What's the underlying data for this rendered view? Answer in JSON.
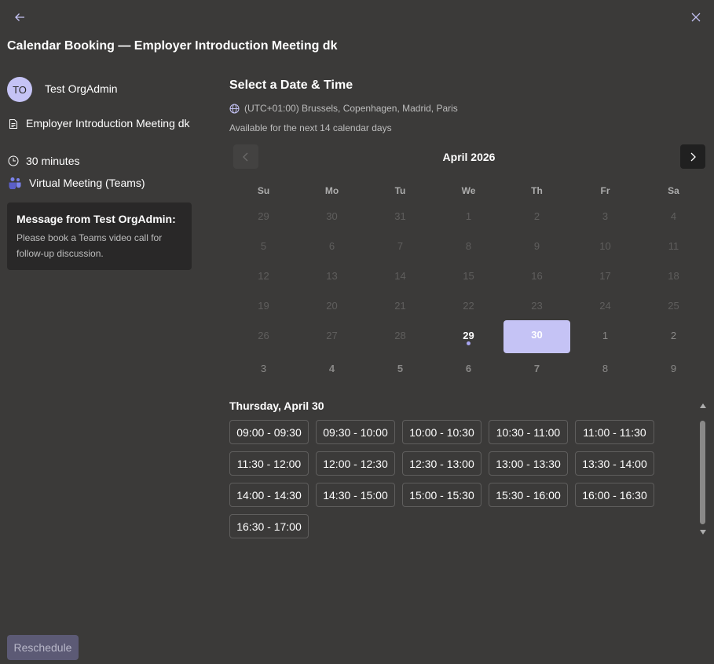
{
  "header": {
    "title": "Calendar Booking — Employer Introduction Meeting dk",
    "back_icon": "arrow-left-icon",
    "close_icon": "close-icon"
  },
  "organizer": {
    "initials": "TO",
    "name": "Test OrgAdmin"
  },
  "meeting": {
    "title": "Employer Introduction Meeting dk",
    "duration": "30 minutes",
    "location": "Virtual Meeting (Teams)"
  },
  "message": {
    "title": "Message from Test OrgAdmin:",
    "text": "Please book a Teams video call for follow-up discussion."
  },
  "scheduler": {
    "title": "Select a Date & Time",
    "timezone": "(UTC+01:00) Brussels, Copenhagen, Madrid, Paris",
    "availability": "Available for the next 14 calendar days",
    "month_label": "April 2026",
    "weekdays": [
      "Su",
      "Mo",
      "Tu",
      "We",
      "Th",
      "Fr",
      "Sa"
    ],
    "weeks": [
      [
        "29",
        "30",
        "31",
        "1",
        "2",
        "3",
        "4"
      ],
      [
        "5",
        "6",
        "7",
        "8",
        "9",
        "10",
        "11"
      ],
      [
        "12",
        "13",
        "14",
        "15",
        "16",
        "17",
        "18"
      ],
      [
        "19",
        "20",
        "21",
        "22",
        "23",
        "24",
        "25"
      ],
      [
        "26",
        "27",
        "28",
        "29",
        "30",
        "1",
        "2"
      ],
      [
        "3",
        "4",
        "5",
        "6",
        "7",
        "8",
        "9"
      ]
    ],
    "today": "29",
    "selected": "30",
    "selected_day_label": "Thursday, April 30",
    "time_slots": [
      "09:00 - 09:30",
      "09:30 - 10:00",
      "10:00 - 10:30",
      "10:30 - 11:00",
      "11:00 - 11:30",
      "11:30 - 12:00",
      "12:00 - 12:30",
      "12:30 - 13:00",
      "13:00 - 13:30",
      "13:30 - 14:00",
      "14:00 - 14:30",
      "14:30 - 15:00",
      "15:00 - 15:30",
      "15:30 - 16:00",
      "16:00 - 16:30",
      "16:30 - 17:00"
    ]
  },
  "footer": {
    "reschedule_label": "Reschedule"
  },
  "colors": {
    "background": "#3b3a39",
    "accent": "#c5c3f5",
    "panel": "#292828"
  }
}
